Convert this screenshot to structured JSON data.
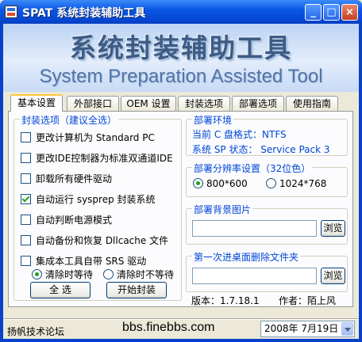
{
  "window": {
    "title": "SPAT 系统封装辅助工具",
    "minimize": "_",
    "maximize": "□",
    "close": "×"
  },
  "banner": {
    "title_cn": "系统封装辅助工具",
    "title_en": "System Preparation Assisted Tool"
  },
  "tabs": [
    {
      "label": "基本设置",
      "active": true
    },
    {
      "label": "外部接口",
      "active": false
    },
    {
      "label": "OEM 设置",
      "active": false
    },
    {
      "label": "封装选项",
      "active": false
    },
    {
      "label": "部署选项",
      "active": false
    },
    {
      "label": "使用指南",
      "active": false
    }
  ],
  "options": {
    "group_title": "封装选项（建议全选）",
    "items": [
      {
        "label": "更改计算机为 Standard PC",
        "checked": false
      },
      {
        "label": "更改IDE控制器为标准双通道IDE",
        "checked": false
      },
      {
        "label": "卸载所有硬件驱动",
        "checked": false
      },
      {
        "label": "自动运行 sysprep 封装系统",
        "checked": true
      },
      {
        "label": "自动判断电源模式",
        "checked": false
      },
      {
        "label": "自动备份和恢复 Dllcache 文件",
        "checked": false
      },
      {
        "label": "集成本工具自带 SRS 驱动",
        "checked": false
      }
    ],
    "srs_modes": [
      {
        "label": "清除时等待",
        "selected": true
      },
      {
        "label": "清除时不等待",
        "selected": false
      }
    ]
  },
  "buttons": {
    "select_all": "全  选",
    "start": "开始封装"
  },
  "env": {
    "group_title": "部署环境",
    "line1": "当前 C 盘格式：NTFS",
    "line2": "系统 SP 状态： Service Pack 3"
  },
  "resolution": {
    "group_title": "部署分辨率设置（32位色）",
    "options": [
      {
        "label": "800*600",
        "selected": true
      },
      {
        "label": "1024*768",
        "selected": false
      }
    ]
  },
  "background": {
    "group_title": "部署背景图片",
    "value": "",
    "browse": "浏览"
  },
  "delete_folder": {
    "group_title": "第一次进桌面删除文件夹",
    "value": "",
    "browse": "浏览"
  },
  "footer_info": {
    "version": "版本：1.7.18.1",
    "author": "作者：陌上风"
  },
  "statusbar": {
    "forum": "扬帆技术论坛",
    "url": "bbs.finebbs.com",
    "date": "2008年  7月19日"
  },
  "colors": {
    "title_blue": "#0a58e6",
    "group_title_blue": "#0046d5",
    "check_green": "#21a121"
  }
}
